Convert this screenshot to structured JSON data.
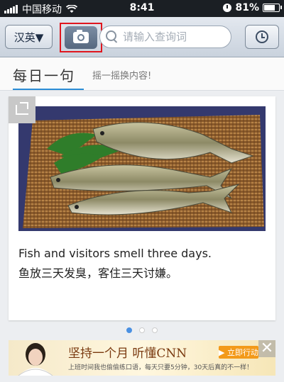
{
  "status_bar": {
    "carrier": "中国移动",
    "time": "8:41",
    "battery_text": "81%",
    "battery_level": 0.81
  },
  "toolbar": {
    "lang_label": "汉英▼",
    "search_placeholder": "请输入查询词"
  },
  "tabs": {
    "main_label": "每日一句",
    "hint": "摇一摇换内容!"
  },
  "daily": {
    "quote_en": "Fish and visitors smell three days.",
    "quote_zh": "鱼放三天发臭，客住三天讨嫌。"
  },
  "pager": {
    "count": 3,
    "active": 0
  },
  "ad": {
    "title": "坚持一个月  听懂CNN",
    "cta": "▶ 立即行动",
    "subtitle": "上班时间我也偷偷练口语，每天只要5分钟，30天后真的不一样！",
    "close": "✕"
  },
  "colors": {
    "accent": "#2b8cd6",
    "highlight_box": "#e0161e"
  },
  "icons": [
    "wifi-icon",
    "camera-icon",
    "search-icon",
    "clock-icon",
    "share-icon",
    "close-icon"
  ]
}
